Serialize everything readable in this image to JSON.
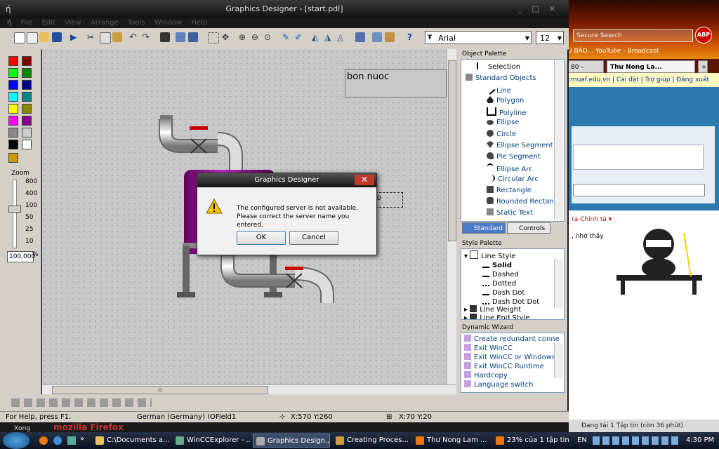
{
  "window": {
    "title": "Graphics Designer - [start.pdl]",
    "menu": [
      "File",
      "Edit",
      "View",
      "Arrange",
      "Tools",
      "Window",
      "Help"
    ]
  },
  "toolbar": {
    "font": "Arial",
    "font_size": "12"
  },
  "zoom": {
    "label": "Zoom",
    "levels": [
      "800",
      "400",
      "100",
      "50",
      "25",
      "10"
    ],
    "value": "100,000",
    "unit": "%"
  },
  "canvas": {
    "text_object": "bon nuoc",
    "field_text": "0"
  },
  "object_palette": {
    "title": "Object Palette",
    "items": [
      "Selection",
      "Standard Objects",
      "Line",
      "Polygon",
      "Polyline",
      "Ellipse",
      "Circle",
      "Ellipse Segment",
      "Pie Segment",
      "Ellipse Arc",
      "Circular Arc",
      "Rectangle",
      "Rounded Rectan",
      "Static Text"
    ],
    "tabs": [
      "Standard",
      "Controls"
    ]
  },
  "style_palette": {
    "title": "Style Palette",
    "items": [
      "Line Style",
      "Solid",
      "Dashed",
      "Dotted",
      "Dash Dot",
      "Dash Dot Dot",
      "Line Weight",
      "Line End Style"
    ]
  },
  "dynamic_wizard": {
    "title": "Dynamic Wizard",
    "items": [
      "Create redundant conne",
      "Exit WinCC",
      "Exit WinCC or Windows",
      "Exit WinCC Runtime",
      "Hardcopy",
      "Language switch"
    ]
  },
  "status": {
    "help": "For Help, press F1.",
    "language": "German (Germany)",
    "object": "IOField1",
    "position": "X:570 Y:260",
    "size": "X:70 Y:20"
  },
  "dialog": {
    "title": "Graphics Designer",
    "message_line1": "The configured server is not available.",
    "message_line2": "Please correct the server name you entered.",
    "ok": "OK",
    "cancel": "Cancel",
    "close": "✕"
  },
  "browser": {
    "search_placeholder": "Secure Search",
    "abp": "ABP",
    "bookmarks": "U BÁO...  YouTube - Broadcast",
    "tab1": "80 –",
    "tab2": "Thư Nong La...",
    "links": "cmuaf.edu.vn | Cài đặt | Trợ giúp | Đăng xuất",
    "side_link": "ra Chính tả ▾",
    "side_text": ", nhớ thầy",
    "status": "Đang tải 1 Tập tin (còn 36 phút)",
    "brand": "mozilla Firefox",
    "xong": "Xong"
  },
  "taskbar": {
    "items": [
      "C:\\Documents a...",
      "WinCCExplorer - ...",
      "Graphics Design...",
      "Creating Proces...",
      "Thư Nong Lam ...",
      "23% của 1 tập tin..."
    ],
    "lang": "EN",
    "clock": "4:30 PM"
  }
}
